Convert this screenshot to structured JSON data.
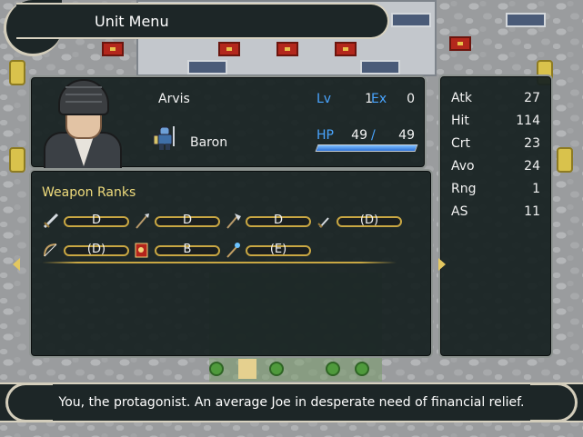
{
  "screen": {
    "title": "Unit Menu"
  },
  "unit": {
    "name": "Arvis",
    "class_name": "Baron",
    "level_label": "Lv",
    "level": "1",
    "exp_label": "Ex",
    "exp": "0",
    "hp_label": "HP",
    "hp_current": "49",
    "hp_separator": "/",
    "hp_max": "49",
    "hp_fraction": 1.0
  },
  "stats": [
    {
      "name": "Atk",
      "value": "27"
    },
    {
      "name": "Hit",
      "value": "114"
    },
    {
      "name": "Crt",
      "value": "23"
    },
    {
      "name": "Avo",
      "value": "24"
    },
    {
      "name": "Rng",
      "value": "1"
    },
    {
      "name": "AS",
      "value": "11"
    }
  ],
  "weapon_ranks": {
    "title": "Weapon Ranks",
    "items": [
      {
        "icon": "sword-icon",
        "grade": "D"
      },
      {
        "icon": "lance-icon",
        "grade": "D"
      },
      {
        "icon": "axe-icon",
        "grade": "D"
      },
      {
        "icon": "dagger-icon",
        "grade": "(D)"
      },
      {
        "icon": "bow-icon",
        "grade": "(D)"
      },
      {
        "icon": "tome-icon",
        "grade": "B"
      },
      {
        "icon": "staff-icon",
        "grade": "(E)"
      }
    ]
  },
  "help": {
    "text": "You, the protagonist.  An average Joe in desperate need of financial relief."
  },
  "colors": {
    "label_blue": "#49a5ff",
    "rank_gold": "#c9a743",
    "title_yellow": "#f0dc7c",
    "panel_bg": "#172222"
  }
}
